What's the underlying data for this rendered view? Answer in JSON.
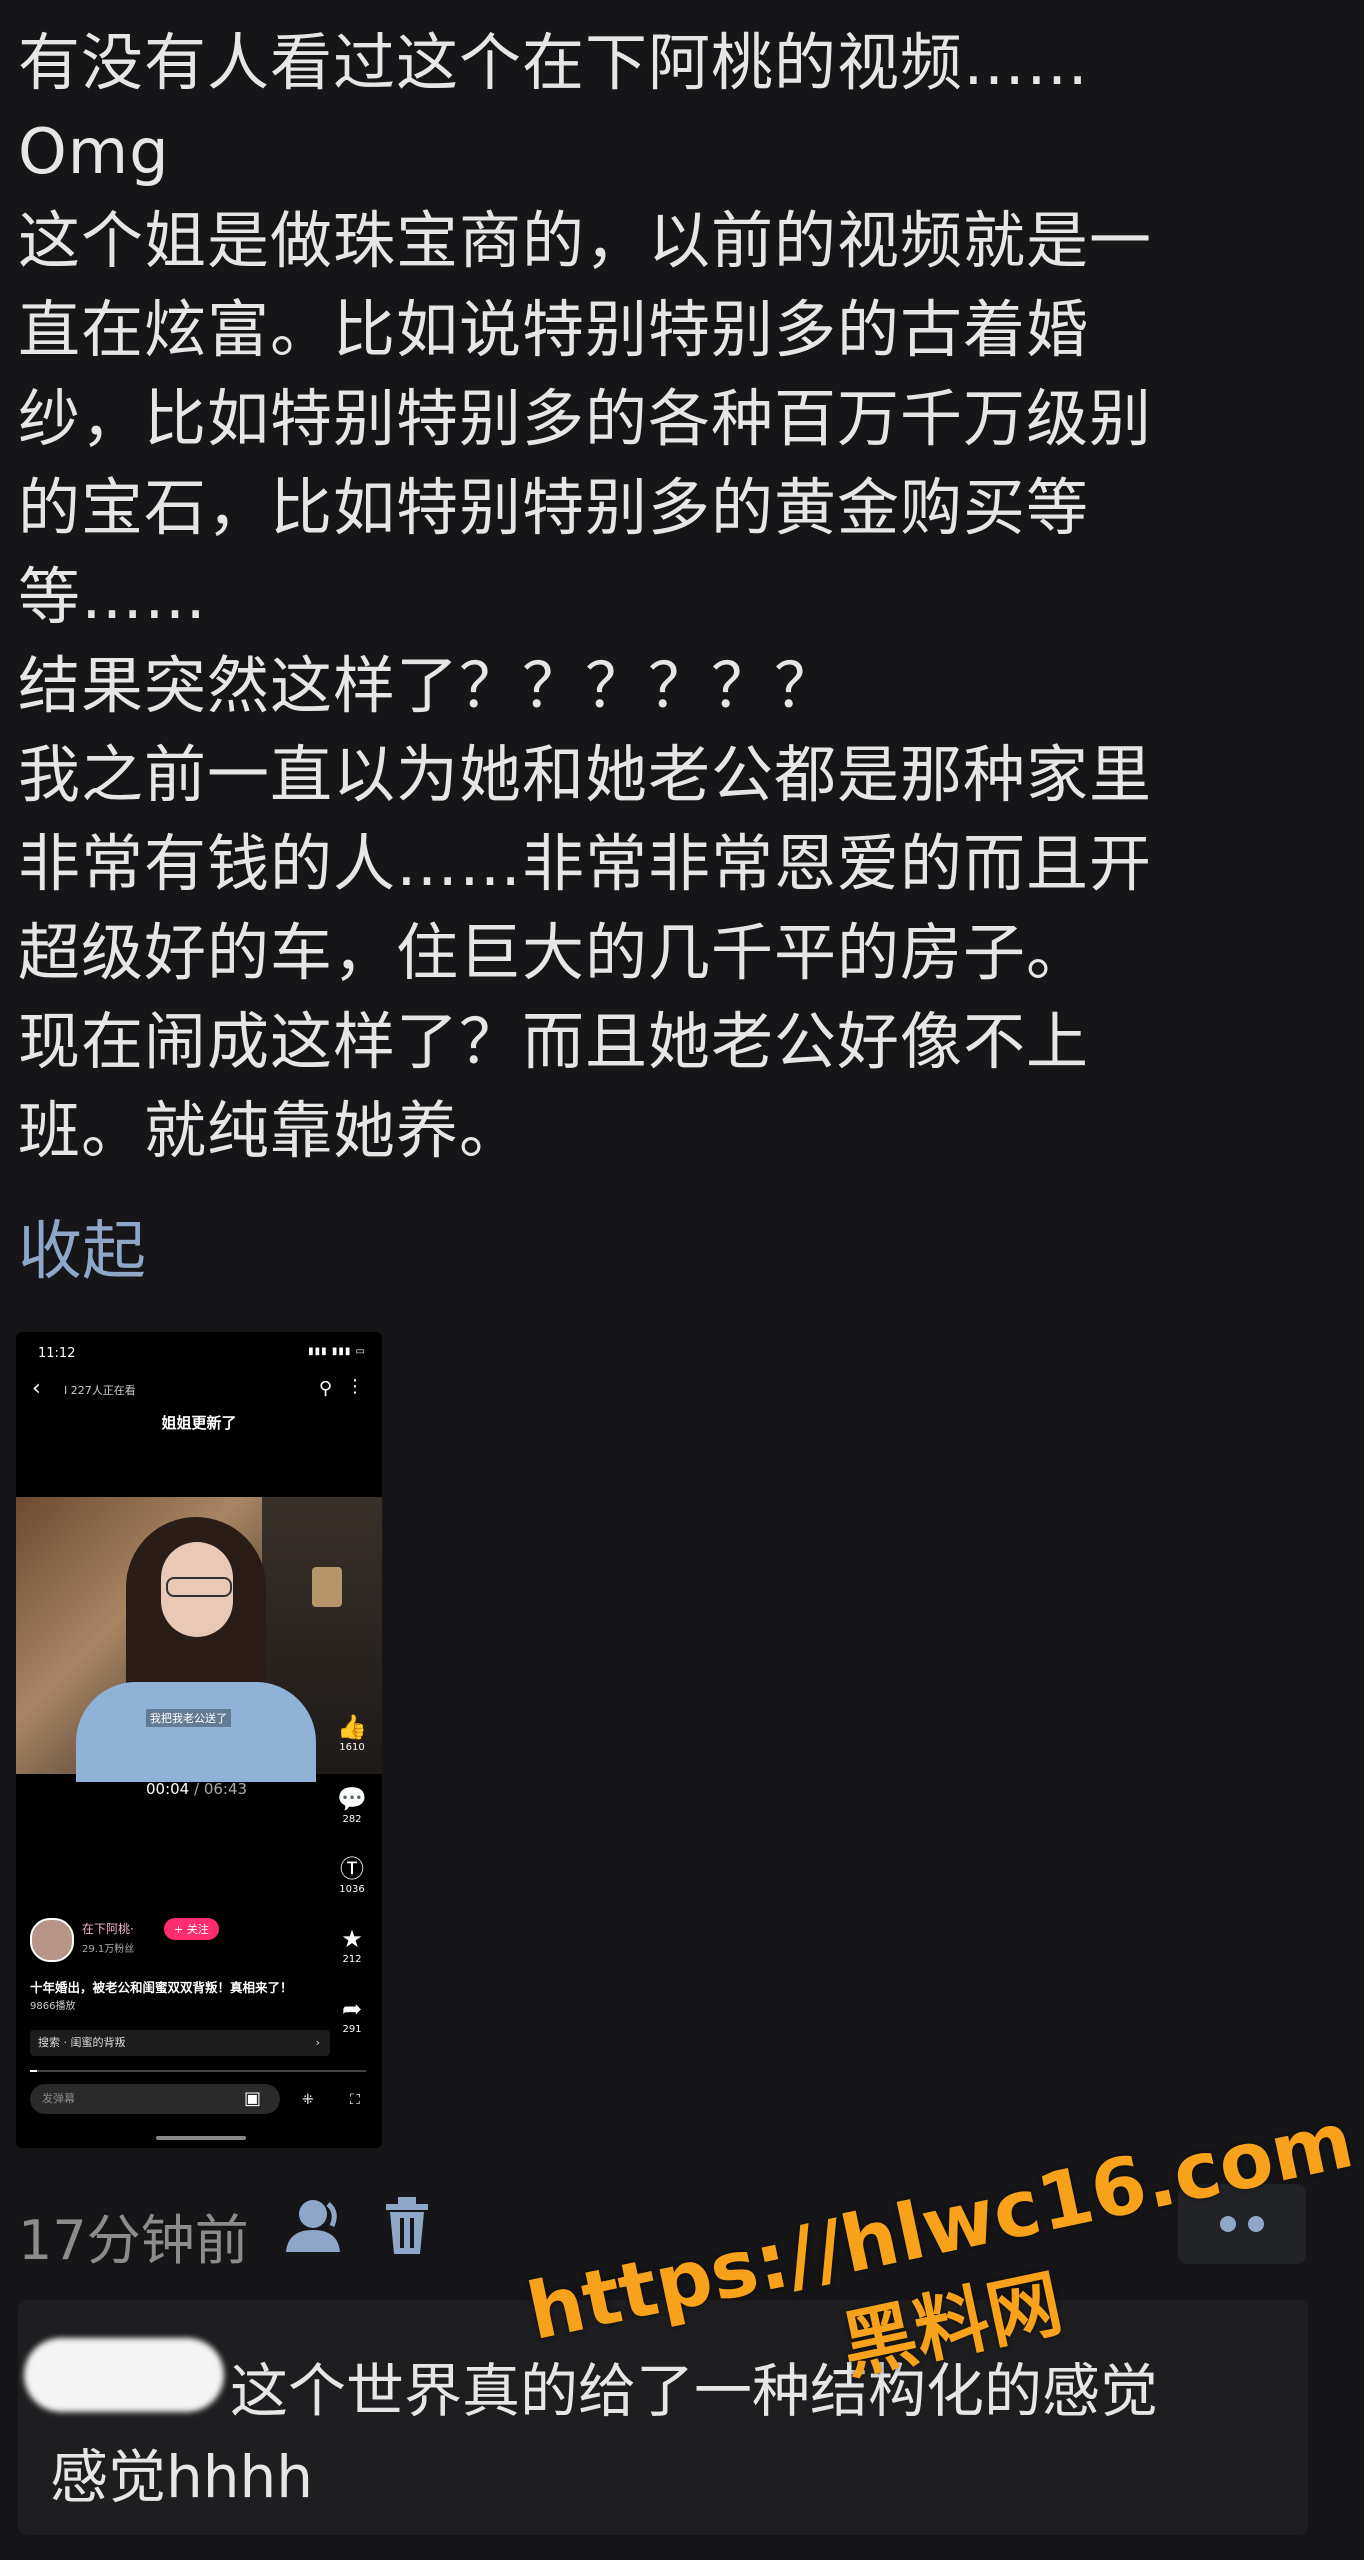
{
  "post": {
    "lines": [
      "有没有人看过这个在下阿桃的视频……",
      "Omg",
      "这个姐是做珠宝商的，以前的视频就是一",
      "直在炫富。比如说特别特别多的古着婚",
      "纱，比如特别特别多的各种百万千万级别",
      "的宝石，比如特别特别多的黄金购买等",
      "等……",
      "结果突然这样了？？？？？？",
      "我之前一直以为她和她老公都是那种家里",
      "非常有钱的人……非常非常恩爱的而且开",
      "超级好的车，住巨大的几千平的房子。",
      "现在闹成这样了？而且她老公好像不上",
      "班。就纯靠她养。"
    ],
    "collapse_label": "收起",
    "time_ago": "17分钟前",
    "icons": {
      "person": "person-icon",
      "delete": "trash-icon",
      "more": "more-dots-icon"
    }
  },
  "embedded_screenshot": {
    "status_time": "11:12",
    "viewers": "Ⅰ 227人正在看",
    "video_title": "姐姐更新了",
    "video_caption": "我把我老公送了",
    "time_current": "00:04",
    "time_total": "06:43",
    "side_counts": {
      "likes": "1610",
      "comments": "282",
      "coins": "1036",
      "favorites": "212",
      "shares": "291"
    },
    "author": "在下阿桃·",
    "fans": "29.1万粉丝",
    "follow_label": "+ 关注",
    "description": "十年婚出，被老公和闺蜜双双背叛！真相来了！",
    "plays": "9866播放",
    "search_text": "搜索 · 闺蜜的背叛",
    "comment_placeholder": "发弹幕",
    "progress_fraction": 0.02
  },
  "reply": {
    "text_line1": "这个世界真的给了一种结构化的感觉",
    "text_line2": "感觉hhhh"
  },
  "watermark": {
    "url": "https://hlwc16.com",
    "site": "黑料网",
    "color": "#f7a21a"
  },
  "colors": {
    "background": "#161618",
    "link": "#8ea6c7",
    "muted": "#8c8c8c"
  }
}
